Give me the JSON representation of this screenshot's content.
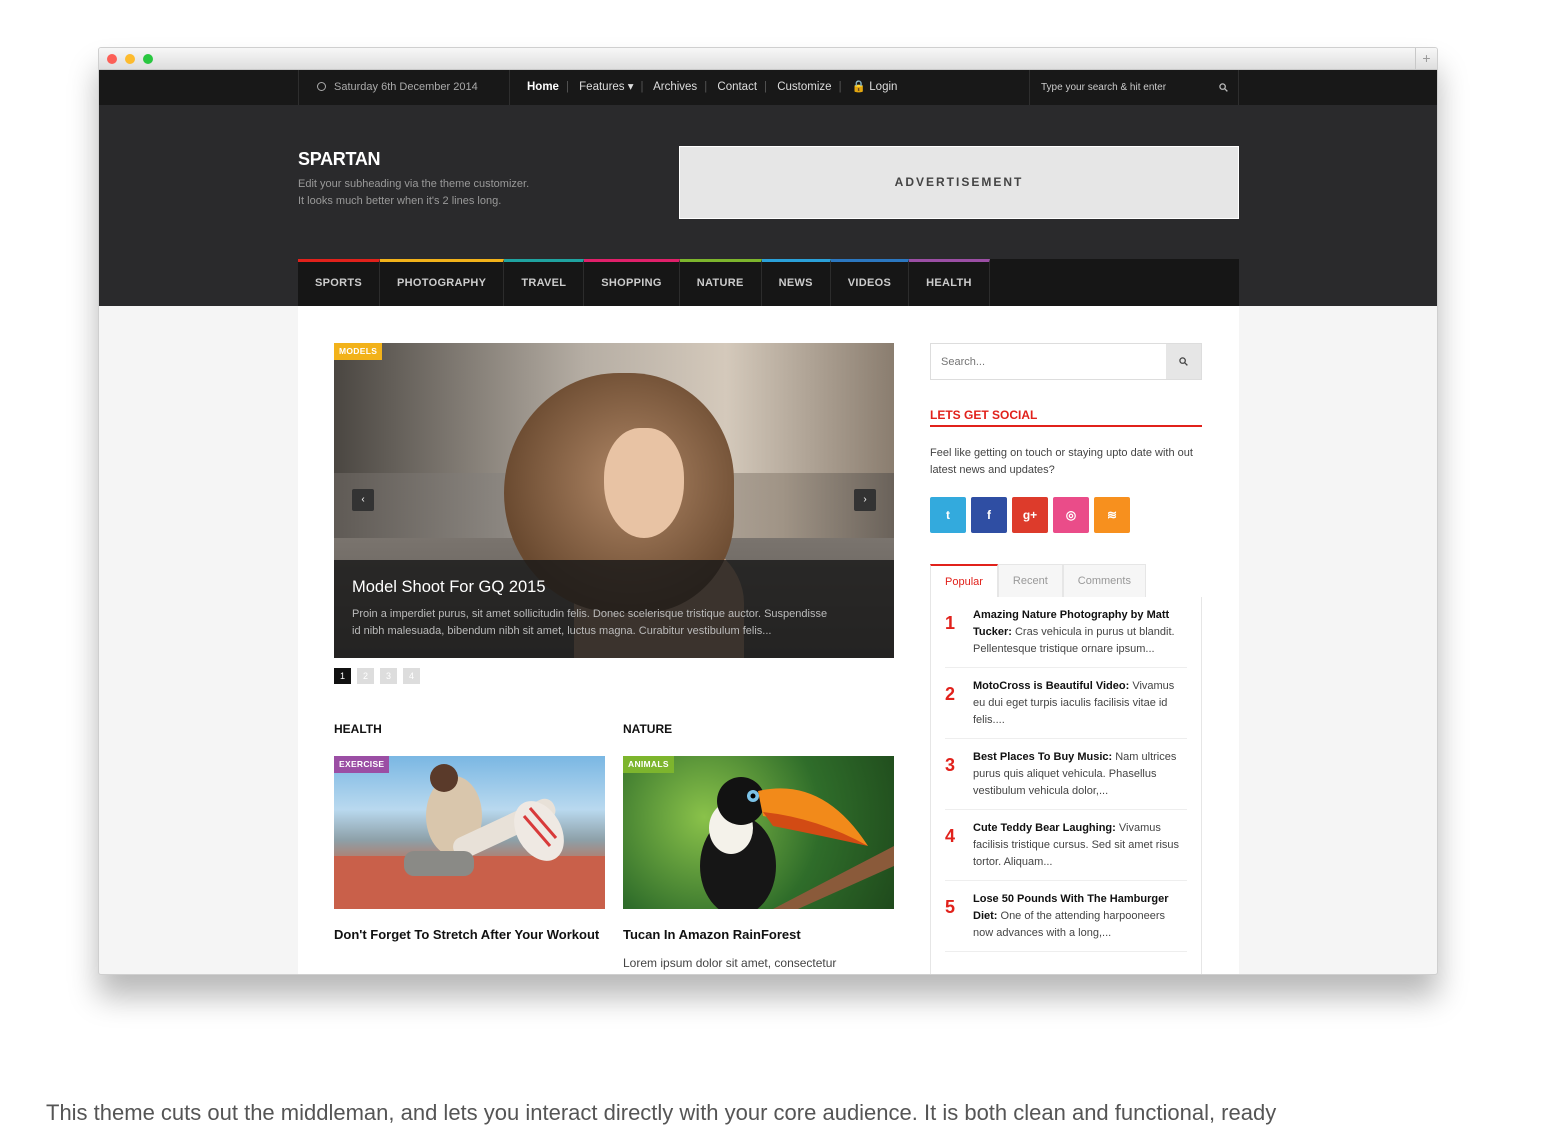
{
  "window": {
    "plus_label": "+"
  },
  "topbar": {
    "date": "Saturday 6th December 2014",
    "nav": [
      "Home",
      "Features ▾",
      "Archives",
      "Contact",
      "Customize",
      "🔒 Login"
    ],
    "search_placeholder": "Type your search & hit enter"
  },
  "header": {
    "logo": "SPARTAN",
    "tagline_1": "Edit your subheading via the theme customizer.",
    "tagline_2": "It looks much better when it's 2 lines long.",
    "ad": "ADVERTISEMENT"
  },
  "categories": [
    {
      "label": "SPORTS",
      "color": "#e1211b"
    },
    {
      "label": "PHOTOGRAPHY",
      "color": "#f2b21a"
    },
    {
      "label": "TRAVEL",
      "color": "#1fa3a0"
    },
    {
      "label": "SHOPPING",
      "color": "#e0206a"
    },
    {
      "label": "NATURE",
      "color": "#7db52d"
    },
    {
      "label": "NEWS",
      "color": "#2aa0d8"
    },
    {
      "label": "VIDEOS",
      "color": "#2b77c0"
    },
    {
      "label": "HEALTH",
      "color": "#9b4ea4"
    }
  ],
  "slider": {
    "badge": "MODELS",
    "prev": "‹",
    "next": "›",
    "title": "Model Shoot For GQ 2015",
    "text_1": "Proin a imperdiet purus, sit amet sollicitudin felis. Donec scelerisque tristique auctor. Suspendisse",
    "text_2": "id nibh malesuada, bibendum nibh sit amet, luctus magna. Curabitur vestibulum felis...",
    "pages": [
      "1",
      "2",
      "3",
      "4"
    ]
  },
  "sections": {
    "health": {
      "heading": "HEALTH",
      "badge": "EXERCISE",
      "title": "Don't Forget To Stretch After Your Workout"
    },
    "nature": {
      "heading": "NATURE",
      "badge": "ANIMALS",
      "title": "Tucan In Amazon RainForest",
      "excerpt": "Lorem ipsum dolor sit amet, consectetur"
    }
  },
  "sidebar": {
    "search_placeholder": "Search...",
    "social_heading": "LETS GET SOCIAL",
    "social_text": "Feel like getting on touch or staying upto date with out latest news and updates?",
    "social": [
      {
        "icon": "twitter-icon",
        "glyph": "t",
        "color": "#33aadd"
      },
      {
        "icon": "facebook-icon",
        "glyph": "f",
        "color": "#2f4ea3"
      },
      {
        "icon": "googleplus-icon",
        "glyph": "g+",
        "color": "#dd3b2b"
      },
      {
        "icon": "dribbble-icon",
        "glyph": "◎",
        "color": "#ea4c89"
      },
      {
        "icon": "rss-icon",
        "glyph": "≋",
        "color": "#f7901e"
      }
    ],
    "tabs": [
      "Popular",
      "Recent",
      "Comments"
    ],
    "popular": [
      {
        "num": "1",
        "title": "Amazing Nature Photography by Matt Tucker:",
        "text": " Cras vehicula in purus ut blandit. Pellentesque tristique ornare ipsum..."
      },
      {
        "num": "2",
        "title": "MotoCross is Beautiful Video:",
        "text": " Vivamus eu dui eget turpis iaculis facilisis vitae id felis...."
      },
      {
        "num": "3",
        "title": "Best Places To Buy Music:",
        "text": " Nam ultrices purus quis aliquet vehicula. Phasellus vestibulum vehicula dolor,..."
      },
      {
        "num": "4",
        "title": "Cute Teddy Bear Laughing:",
        "text": " Vivamus facilisis tristique cursus. Sed sit amet risus tortor. Aliquam..."
      },
      {
        "num": "5",
        "title": "Lose 50 Pounds With The Hamburger Diet:",
        "text": " One of the attending harpooneers now advances with a long,..."
      }
    ]
  },
  "bottom_text": "This theme cuts out the middleman, and lets you interact directly with your core audience. It is both clean and functional, ready"
}
